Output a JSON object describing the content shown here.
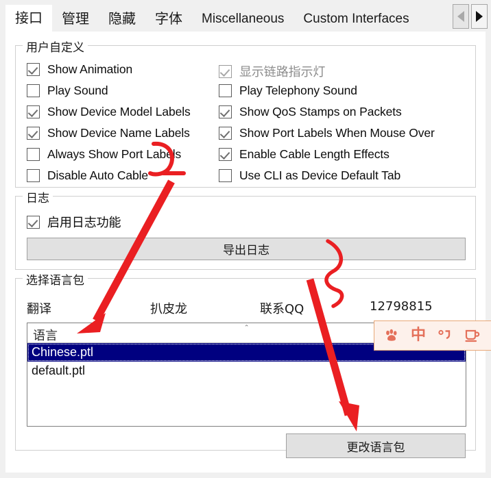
{
  "window": {
    "tabs": [
      {
        "label": "接口",
        "cjk": true,
        "active": true
      },
      {
        "label": "管理",
        "cjk": true,
        "active": false
      },
      {
        "label": "隐藏",
        "cjk": true,
        "active": false
      },
      {
        "label": "字体",
        "cjk": true,
        "active": false
      },
      {
        "label": "Miscellaneous",
        "cjk": false,
        "active": false
      },
      {
        "label": "Custom Interfaces",
        "cjk": false,
        "active": false
      }
    ],
    "scroll_left_icon": "triangle-left-icon",
    "scroll_right_icon": "triangle-right-icon"
  },
  "user_customize": {
    "title": "用户自定义",
    "left_options": [
      {
        "label": "Show Animation",
        "checked": true,
        "disabled": false
      },
      {
        "label": "Play Sound",
        "checked": false,
        "disabled": false
      },
      {
        "label": "Show Device Model Labels",
        "checked": true,
        "disabled": false
      },
      {
        "label": "Show Device Name Labels",
        "checked": true,
        "disabled": false
      },
      {
        "label": "Always Show Port Labels",
        "checked": false,
        "disabled": false
      },
      {
        "label": "Disable Auto Cable",
        "checked": false,
        "disabled": false
      }
    ],
    "right_options": [
      {
        "label": "显示链路指示灯",
        "checked": true,
        "disabled": true,
        "cjk": true
      },
      {
        "label": "Play Telephony Sound",
        "checked": false,
        "disabled": false
      },
      {
        "label": "Show QoS Stamps on Packets",
        "checked": true,
        "disabled": false
      },
      {
        "label": "Show Port Labels When Mouse Over",
        "checked": true,
        "disabled": false
      },
      {
        "label": "Enable Cable Length Effects",
        "checked": true,
        "disabled": false
      },
      {
        "label": "Use CLI as Device Default Tab",
        "checked": false,
        "disabled": false
      }
    ]
  },
  "log": {
    "title": "日志",
    "enable_label": "启用日志功能",
    "enable_checked": true,
    "export_button": "导出日志"
  },
  "language": {
    "title": "选择语言包",
    "credits": {
      "translate_label": "翻译",
      "translator_name": "扒皮龙",
      "contact_label": "联系QQ",
      "contact_value": "12798815"
    },
    "list_header": "语言",
    "sort_caret": "＾",
    "items": [
      {
        "label": "Chinese.ptl",
        "selected": true
      },
      {
        "label": "default.ptl",
        "selected": false
      }
    ],
    "change_button": "更改语言包"
  },
  "ime_bar": {
    "icons": [
      {
        "name": "baidu-paw-icon",
        "glyph": "❧"
      },
      {
        "name": "chinese-mode-icon",
        "glyph": "中"
      },
      {
        "name": "punctuation-mode-icon",
        "glyph": "°,"
      },
      {
        "name": "toolbox-icon",
        "glyph": "▭"
      }
    ]
  },
  "annotations": {
    "accent_color": "#ea1f22",
    "arrow_one": "curve-hook-then-arrow-to-chinese-ptl",
    "arrow_two": "squiggle-then-arrow-to-change-language-button"
  }
}
